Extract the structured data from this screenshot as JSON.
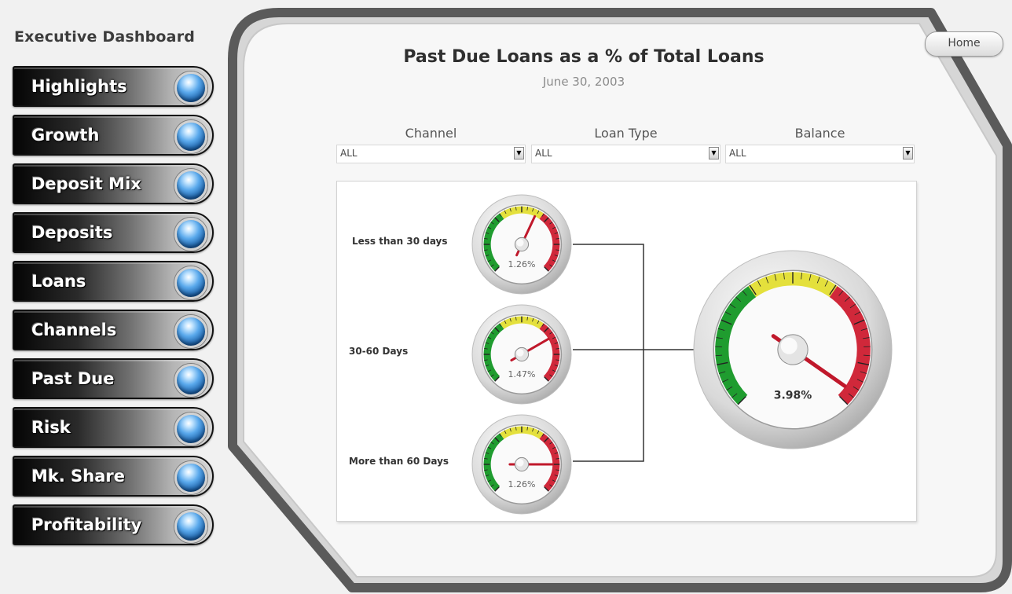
{
  "app": {
    "title": "Executive Dashboard"
  },
  "nav": {
    "items": [
      {
        "label": "Highlights"
      },
      {
        "label": "Growth"
      },
      {
        "label": "Deposit Mix"
      },
      {
        "label": "Deposits"
      },
      {
        "label": "Loans"
      },
      {
        "label": "Channels"
      },
      {
        "label": "Past Due"
      },
      {
        "label": "Risk"
      },
      {
        "label": "Mk. Share"
      },
      {
        "label": "Profitability"
      }
    ]
  },
  "header": {
    "home_label": "Home",
    "title": "Past Due Loans as a % of Total Loans",
    "subtitle": "June 30, 2003"
  },
  "filters": [
    {
      "label": "Channel",
      "value": "ALL"
    },
    {
      "label": "Loan Type",
      "value": "ALL"
    },
    {
      "label": "Balance",
      "value": "ALL"
    }
  ],
  "gauges": {
    "small": [
      {
        "label": "Less than 30 days",
        "value_text": "1.26%",
        "needle_deg": 25
      },
      {
        "label": "30-60 Days",
        "value_text": "1.47%",
        "needle_deg": 60
      },
      {
        "label": "More than 60 Days",
        "value_text": "1.26%",
        "needle_deg": 90
      }
    ],
    "total": {
      "value_text": "3.98%",
      "needle_deg": 125
    }
  },
  "colors": {
    "gauge_green": "#1f9c2f",
    "gauge_yellow": "#e4e03c",
    "gauge_red": "#d0283a",
    "needle": "#c0182b",
    "nav_orb": "#3a8ad8",
    "frame_dark": "#4a4a4a"
  }
}
